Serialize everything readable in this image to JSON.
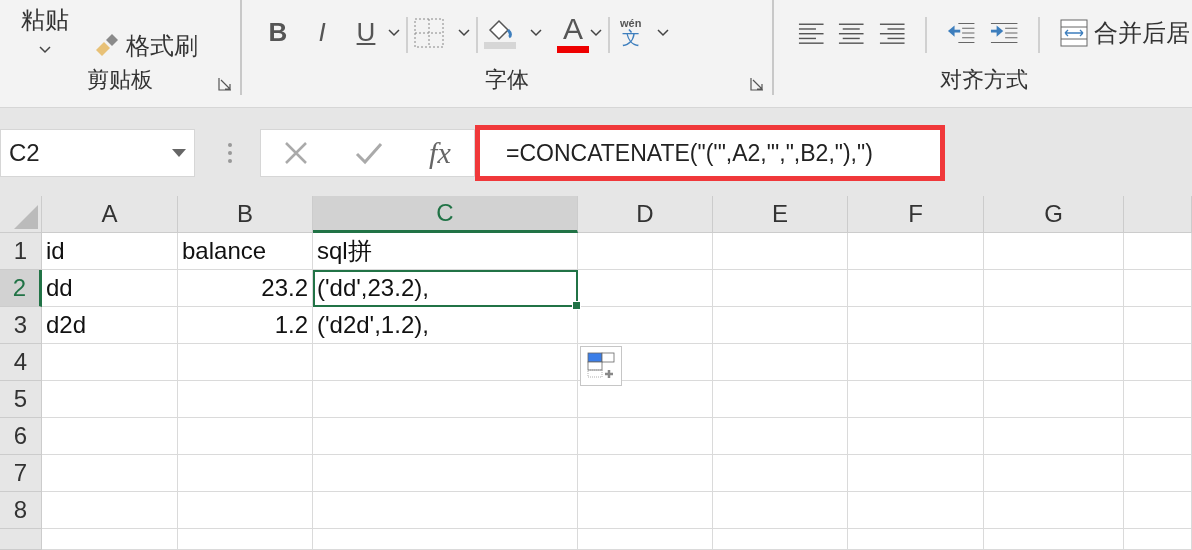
{
  "ribbon": {
    "clipboard": {
      "label": "剪贴板",
      "paste": "粘贴",
      "format_painter": "格式刷"
    },
    "font": {
      "label": "字体",
      "bold": "B",
      "italic": "I",
      "underline": "U",
      "font_color": "A",
      "phonetic_top": "wén",
      "phonetic_char": "文"
    },
    "alignment": {
      "label": "对齐方式",
      "merge": "合并后居"
    }
  },
  "formula_bar": {
    "name_box": "C2",
    "fx": "fx",
    "formula": "=CONCATENATE(\"('\",A2,\"',\",B2,\"),\")",
    "highlighted": true
  },
  "sheet": {
    "columns": [
      {
        "label": "A",
        "selected": false
      },
      {
        "label": "B",
        "selected": false
      },
      {
        "label": "C",
        "selected": true
      },
      {
        "label": "D",
        "selected": false
      },
      {
        "label": "E",
        "selected": false
      },
      {
        "label": "F",
        "selected": false
      },
      {
        "label": "G",
        "selected": false
      }
    ],
    "rows": [
      {
        "label": "1",
        "selected": false,
        "cells": [
          {
            "text": "id",
            "kind": "text",
            "selected": false
          },
          {
            "text": "balance",
            "kind": "text",
            "selected": false
          },
          {
            "text": "sql拼",
            "kind": "text",
            "selected": false
          }
        ]
      },
      {
        "label": "2",
        "selected": true,
        "cells": [
          {
            "text": "dd",
            "kind": "text",
            "selected": false
          },
          {
            "text": "23.2",
            "kind": "number",
            "selected": false
          },
          {
            "text": "('dd',23.2),",
            "kind": "text",
            "selected": true
          }
        ]
      },
      {
        "label": "3",
        "selected": false,
        "cells": [
          {
            "text": "d2d",
            "kind": "text",
            "selected": false
          },
          {
            "text": "1.2",
            "kind": "number",
            "selected": false
          },
          {
            "text": "('d2d',1.2),",
            "kind": "text",
            "selected": false
          }
        ]
      },
      {
        "label": "4",
        "selected": false,
        "cells": []
      },
      {
        "label": "5",
        "selected": false,
        "cells": []
      },
      {
        "label": "6",
        "selected": false,
        "cells": []
      },
      {
        "label": "7",
        "selected": false,
        "cells": []
      },
      {
        "label": "8",
        "selected": false,
        "cells": []
      }
    ]
  }
}
